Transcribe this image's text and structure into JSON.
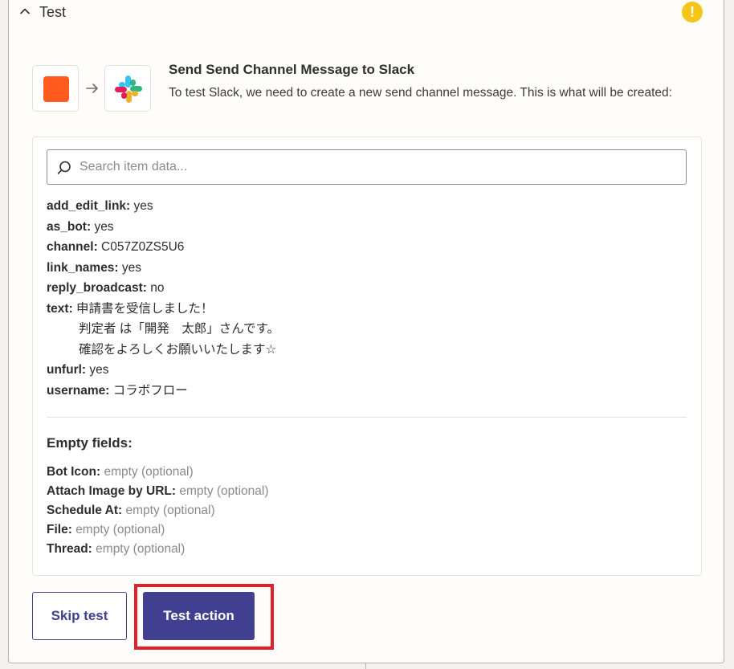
{
  "section": {
    "title": "Test",
    "chevron_icon": "chevron-up-icon",
    "warning_icon": "warning-icon",
    "warning_glyph": "!",
    "warning_color": "#f5c518"
  },
  "apps": {
    "trigger_icon": "trigger-app-icon",
    "trigger_color": "#ff5a1f",
    "arrow_icon": "arrow-right-icon",
    "action_icon": "slack-icon"
  },
  "action": {
    "title": "Send Send Channel Message to Slack",
    "description": "To test Slack, we need to create a new send channel message. This is what will be created:"
  },
  "search": {
    "placeholder": "Search item data...",
    "value": ""
  },
  "fields": [
    {
      "key": "add_edit_link:",
      "value": "yes"
    },
    {
      "key": "as_bot:",
      "value": "yes"
    },
    {
      "key": "channel:",
      "value": "C057Z0ZS5U6"
    },
    {
      "key": "link_names:",
      "value": "yes"
    },
    {
      "key": "reply_broadcast:",
      "value": "no"
    },
    {
      "key": "text:",
      "value": "申請書を受信しました！",
      "continuation": [
        "判定者 は「開発　太郎」さんです。",
        "確認をよろしくお願いいたします☆"
      ]
    },
    {
      "key": "unfurl:",
      "value": "yes"
    },
    {
      "key": "username:",
      "value": "コラボフロー"
    }
  ],
  "empty_fields": {
    "title": "Empty fields:",
    "items": [
      {
        "key": "Bot Icon:",
        "value": "empty (optional)"
      },
      {
        "key": "Attach Image by URL:",
        "value": "empty (optional)"
      },
      {
        "key": "Schedule At:",
        "value": "empty (optional)"
      },
      {
        "key": "File:",
        "value": "empty (optional)"
      },
      {
        "key": "Thread:",
        "value": "empty (optional)"
      }
    ]
  },
  "buttons": {
    "skip_label": "Skip test",
    "test_label": "Test action",
    "primary_color": "#403f90",
    "highlight_color": "#e4202a"
  }
}
